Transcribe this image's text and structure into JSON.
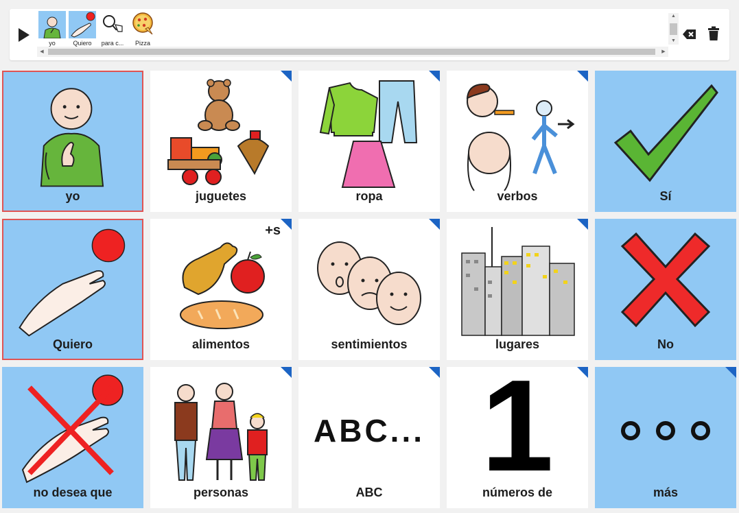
{
  "sentence_bar": {
    "items": [
      {
        "label": "yo",
        "icon": "person-pointing-self-icon",
        "selected": true
      },
      {
        "label": "Quiero",
        "icon": "hand-reaching-ball-icon",
        "selected": true
      },
      {
        "label": "para c...",
        "icon": "magnifier-hand-icon",
        "selected": false
      },
      {
        "label": "Pizza",
        "icon": "pizza-icon",
        "selected": false
      }
    ]
  },
  "tiles": [
    {
      "label": "yo",
      "icon": "person-pointing-self-icon",
      "style": "blue",
      "folder": false,
      "highlighted": true
    },
    {
      "label": "juguetes",
      "icon": "toys-icon",
      "style": "white",
      "folder": true
    },
    {
      "label": "ropa",
      "icon": "clothes-icon",
      "style": "white",
      "folder": true
    },
    {
      "label": "verbos",
      "icon": "actions-icon",
      "style": "white",
      "folder": true
    },
    {
      "label": "Sí",
      "icon": "check-mark-icon",
      "style": "blue",
      "folder": false
    },
    {
      "label": "Quiero",
      "icon": "hand-reaching-ball-icon",
      "style": "blue",
      "folder": false,
      "highlighted": true
    },
    {
      "label": "alimentos",
      "icon": "food-icon",
      "style": "white",
      "folder": true
    },
    {
      "label": "sentimientos",
      "icon": "faces-icon",
      "style": "white",
      "folder": true
    },
    {
      "label": "lugares",
      "icon": "city-icon",
      "style": "white",
      "folder": true
    },
    {
      "label": "No",
      "icon": "red-x-icon",
      "style": "blue",
      "folder": false
    },
    {
      "label": "no desea que",
      "icon": "crossed-hand-ball-icon",
      "style": "blue",
      "folder": false
    },
    {
      "label": "personas",
      "icon": "family-icon",
      "style": "white",
      "folder": true
    },
    {
      "label": "ABC",
      "icon": "abc-text-icon",
      "style": "white",
      "folder": true
    },
    {
      "label": "números de",
      "icon": "number-one-icon",
      "style": "white",
      "folder": true
    },
    {
      "label": "más",
      "icon": "more-dots-icon",
      "style": "blue",
      "folder": true
    }
  ],
  "abc_art_text": "ABC...",
  "number_art_text": "1",
  "plural_mark": "+s",
  "colors": {
    "tile_blue": "#90c8f4",
    "highlight_border": "#e05353",
    "folder_corner": "#1c64c4",
    "background": "#f1f1f1"
  }
}
